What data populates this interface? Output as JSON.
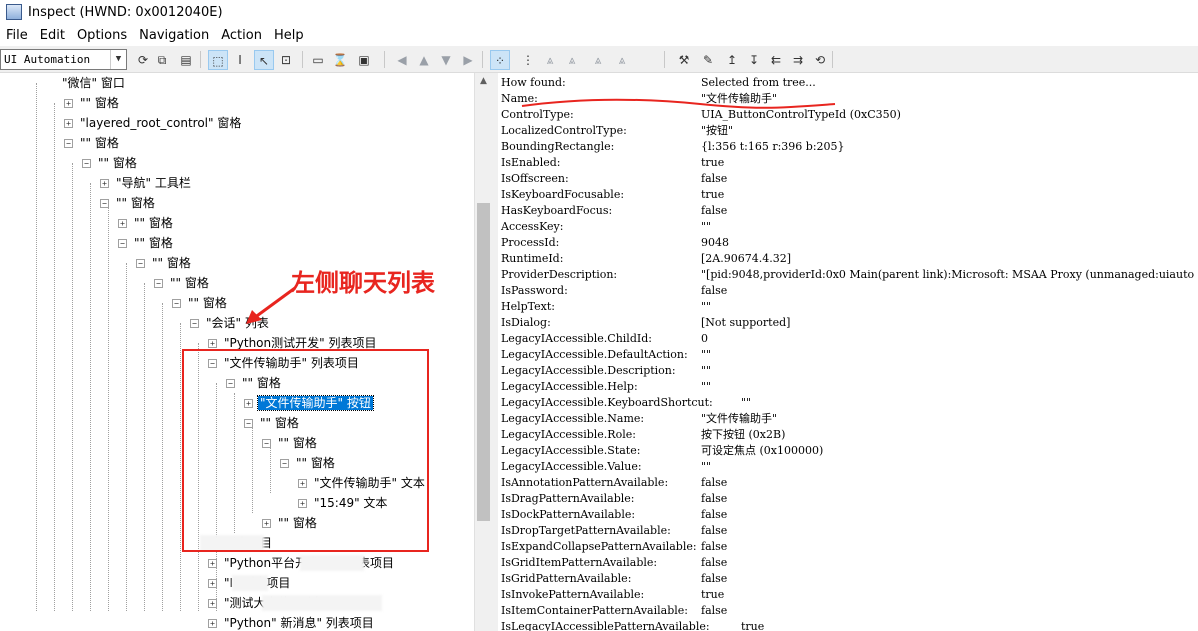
{
  "window": {
    "title": "Inspect  (HWND: 0x0012040E)"
  },
  "menu": [
    "File",
    "Edit",
    "Options",
    "Navigation",
    "Action",
    "Help"
  ],
  "toolbar": {
    "mode_select": "UI Automation",
    "buttons": [
      {
        "name": "watch-focus-icon",
        "glyph": "⟳"
      },
      {
        "name": "copy-icon",
        "glyph": "⧉"
      },
      {
        "name": "properties-icon",
        "glyph": "▤"
      },
      {
        "name": "show-highlight-icon",
        "glyph": "⬚"
      },
      {
        "name": "watch-caret-icon",
        "glyph": "I"
      },
      {
        "name": "watch-cursor-icon",
        "glyph": "↖"
      },
      {
        "name": "watch-tooltip-icon",
        "glyph": "⊡"
      },
      {
        "name": "show-rectangle-icon",
        "glyph": "▭"
      },
      {
        "name": "hourglass-icon",
        "glyph": "⌛"
      },
      {
        "name": "show-text-icon",
        "glyph": "▣"
      },
      {
        "name": "nav-back-icon",
        "glyph": "◀"
      },
      {
        "name": "nav-parent-icon",
        "glyph": "▲"
      },
      {
        "name": "nav-child-icon",
        "glyph": "▼"
      },
      {
        "name": "nav-next-icon",
        "glyph": "▶"
      },
      {
        "name": "tree-view-icon",
        "glyph": "⁘"
      },
      {
        "name": "tree-first-child-icon",
        "glyph": "⋮"
      },
      {
        "name": "tree-prev-sibling-icon",
        "glyph": "⩓"
      },
      {
        "name": "tree-next-sibling-icon",
        "glyph": "⩓"
      },
      {
        "name": "tree-last-child-icon",
        "glyph": "⩓"
      },
      {
        "name": "tree-parent-icon",
        "glyph": "⩓"
      },
      {
        "name": "invoke-icon",
        "glyph": "⚒"
      },
      {
        "name": "highlight-icon",
        "glyph": "✎"
      },
      {
        "name": "move-up-icon",
        "glyph": "↥"
      },
      {
        "name": "move-down-icon",
        "glyph": "↧"
      },
      {
        "name": "move-left-icon",
        "glyph": "⇇"
      },
      {
        "name": "move-right-icon",
        "glyph": "⇉"
      },
      {
        "name": "refresh-icon",
        "glyph": "⟲"
      }
    ]
  },
  "tree": [
    {
      "text": "\"微信\" 窗口",
      "pm": ""
    },
    {
      "text": "\"\" 窗格",
      "pm": "+"
    },
    {
      "text": "\"layered_root_control\" 窗格",
      "pm": "+"
    },
    {
      "text": "\"\" 窗格",
      "pm": "−"
    },
    {
      "text": "\"\" 窗格",
      "pm": "−"
    },
    {
      "text": "\"导航\" 工具栏",
      "pm": "+"
    },
    {
      "text": "\"\" 窗格",
      "pm": "−"
    },
    {
      "text": "\"\" 窗格",
      "pm": "+"
    },
    {
      "text": "\"\" 窗格",
      "pm": "−"
    },
    {
      "text": "\"\" 窗格",
      "pm": "−"
    },
    {
      "text": "\"\" 窗格",
      "pm": "−"
    },
    {
      "text": "\"\" 窗格",
      "pm": "−"
    },
    {
      "text": "\"会话\" 列表",
      "pm": "−"
    },
    {
      "text": "\"Python测试开发\" 列表项目",
      "pm": "+"
    },
    {
      "text": "\"文件传输助手\" 列表项目",
      "pm": "−"
    },
    {
      "text": "\"\" 窗格",
      "pm": "−"
    },
    {
      "text": "\"文件传输助手\" 按钮",
      "pm": "+"
    },
    {
      "text": "\"\" 窗格",
      "pm": "−"
    },
    {
      "text": "\"\" 窗格",
      "pm": "−"
    },
    {
      "text": "\"\" 窗格",
      "pm": "−"
    },
    {
      "text": "\"文件传输助手\" 文本",
      "pm": "+"
    },
    {
      "text": "\"15:49\" 文本",
      "pm": "+"
    },
    {
      "text": "\"\" 窗格",
      "pm": "+"
    },
    {
      "text": "列表项目",
      "pm": ""
    },
    {
      "text": "\"Python平台开发\"期\" 列表项目",
      "pm": "+"
    },
    {
      "text": "\"I\"   列表项目",
      "pm": "+"
    },
    {
      "text": "\"测试大本营\" 列表项目",
      "pm": "+"
    },
    {
      "text": "\"Python\"  新消息\" 列表项目",
      "pm": "+"
    }
  ],
  "properties": [
    {
      "name": "How found:",
      "value": "Selected from tree..."
    },
    {
      "name": "Name:",
      "value": "\"文件传输助手\""
    },
    {
      "name": "ControlType:",
      "value": "UIA_ButtonControlTypeId (0xC350)"
    },
    {
      "name": "LocalizedControlType:",
      "value": "\"按钮\""
    },
    {
      "name": "BoundingRectangle:",
      "value": "{l:356 t:165 r:396 b:205}"
    },
    {
      "name": "IsEnabled:",
      "value": "true"
    },
    {
      "name": "IsOffscreen:",
      "value": "false"
    },
    {
      "name": "IsKeyboardFocusable:",
      "value": "true"
    },
    {
      "name": "HasKeyboardFocus:",
      "value": "false"
    },
    {
      "name": "AccessKey:",
      "value": "\"\""
    },
    {
      "name": "ProcessId:",
      "value": "9048"
    },
    {
      "name": "RuntimeId:",
      "value": "[2A.90674.4.32]"
    },
    {
      "name": "ProviderDescription:",
      "value": "\"[pid:9048,providerId:0x0 Main(parent link):Microsoft: MSAA Proxy (unmanaged:uiauto"
    },
    {
      "name": "IsPassword:",
      "value": "false"
    },
    {
      "name": "HelpText:",
      "value": "\"\""
    },
    {
      "name": "IsDialog:",
      "value": "[Not supported]"
    },
    {
      "name": "LegacyIAccessible.ChildId:",
      "value": "0"
    },
    {
      "name": "LegacyIAccessible.DefaultAction:",
      "value": "\"\""
    },
    {
      "name": "LegacyIAccessible.Description:",
      "value": "\"\""
    },
    {
      "name": "LegacyIAccessible.Help:",
      "value": "\"\""
    },
    {
      "name": "LegacyIAccessible.KeyboardShortcut:",
      "value": "\"\""
    },
    {
      "name": "LegacyIAccessible.Name:",
      "value": "\"文件传输助手\""
    },
    {
      "name": "LegacyIAccessible.Role:",
      "value": "按下按钮 (0x2B)"
    },
    {
      "name": "LegacyIAccessible.State:",
      "value": "可设定焦点 (0x100000)"
    },
    {
      "name": "LegacyIAccessible.Value:",
      "value": "\"\""
    },
    {
      "name": "IsAnnotationPatternAvailable:",
      "value": "false"
    },
    {
      "name": "IsDragPatternAvailable:",
      "value": "false"
    },
    {
      "name": "IsDockPatternAvailable:",
      "value": "false"
    },
    {
      "name": "IsDropTargetPatternAvailable:",
      "value": "false"
    },
    {
      "name": "IsExpandCollapsePatternAvailable:",
      "value": "false"
    },
    {
      "name": "IsGridItemPatternAvailable:",
      "value": "false"
    },
    {
      "name": "IsGridPatternAvailable:",
      "value": "false"
    },
    {
      "name": "IsInvokePatternAvailable:",
      "value": "true"
    },
    {
      "name": "IsItemContainerPatternAvailable:",
      "value": "false"
    },
    {
      "name": "IsLegacyIAccessiblePatternAvailable:",
      "value": "true"
    }
  ],
  "annotation": {
    "label": "左侧聊天列表",
    "color": "#e8251f"
  }
}
